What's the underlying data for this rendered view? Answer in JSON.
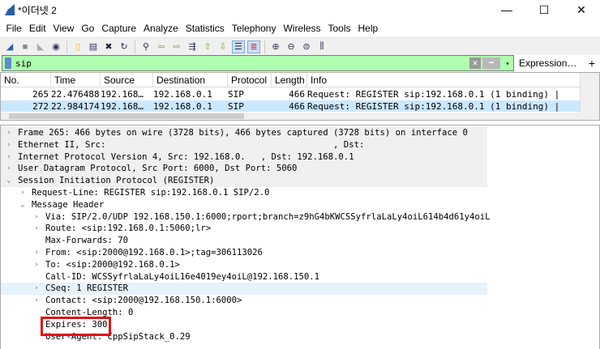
{
  "window": {
    "title": "*이더넷 2",
    "minimize": "—",
    "maximize": "☐",
    "close": "✕"
  },
  "menu": [
    "File",
    "Edit",
    "View",
    "Go",
    "Capture",
    "Analyze",
    "Statistics",
    "Telephony",
    "Wireless",
    "Tools",
    "Help"
  ],
  "toolbar": [
    "start-capture",
    "stop-capture",
    "restart-capture",
    "capture-options",
    "|",
    "open-file",
    "save-file",
    "close-file",
    "reload-file",
    "|",
    "find-packet",
    "go-back",
    "go-forward",
    "go-to-packet",
    "go-first",
    "go-last",
    "autoscroll",
    "colorize",
    "|",
    "zoom-in",
    "zoom-out",
    "normal-size",
    "resize-columns"
  ],
  "filter": {
    "value": "sip",
    "clear": "✕",
    "apply": "➡",
    "dropdown": "▾",
    "expression": "Expression…",
    "add": "+",
    "color": "#afffaf"
  },
  "packet_list": {
    "columns": [
      "No.",
      "Time",
      "Source",
      "Destination",
      "Protocol",
      "Length",
      "Info"
    ],
    "rows": [
      {
        "no": "265",
        "time": "22.476488",
        "source": "192.168…",
        "destination": "192.168.0.1",
        "protocol": "SIP",
        "length": "466",
        "info": "Request: REGISTER sip:192.168.0.1  (1 binding) |",
        "selected": false
      },
      {
        "no": "272",
        "time": "22.984174",
        "source": "192.168…",
        "destination": "192.168.0.1",
        "protocol": "SIP",
        "length": "466",
        "info": "Request: REGISTER sip:192.168.0.1  (1 binding) |",
        "selected": true
      }
    ]
  },
  "details": [
    {
      "indent": 0,
      "arrow": ">",
      "text": "Frame 265: 466 bytes on wire (3728 bits), 466 bytes captured (3728 bits) on interface 0",
      "style": "top"
    },
    {
      "indent": 0,
      "arrow": ">",
      "text": "Ethernet II, Src:                                            , Dst:",
      "style": "top"
    },
    {
      "indent": 0,
      "arrow": ">",
      "text": "Internet Protocol Version 4, Src: 192.168.0.   , Dst: 192.168.0.1",
      "style": "top"
    },
    {
      "indent": 0,
      "arrow": ">",
      "text": "User Datagram Protocol, Src Port: 6000, Dst Port: 5060",
      "style": "top"
    },
    {
      "indent": 0,
      "arrow": "v",
      "text": "Session Initiation Protocol (REGISTER)",
      "style": "top"
    },
    {
      "indent": 1,
      "arrow": ">",
      "text": "Request-Line: REGISTER sip:192.168.0.1 SIP/2.0",
      "style": ""
    },
    {
      "indent": 1,
      "arrow": "v",
      "text": "Message Header",
      "style": ""
    },
    {
      "indent": 2,
      "arrow": ">",
      "text": "Via: SIP/2.0/UDP 192.168.150.1:6000;rport;branch=z9hG4bKWCSSyfrlaLaLy4oiL614b4d61y4oiL",
      "style": ""
    },
    {
      "indent": 2,
      "arrow": ">",
      "text": "Route: <sip:192.168.0.1:5060;lr>",
      "style": ""
    },
    {
      "indent": 2,
      "arrow": "",
      "text": "Max-Forwards: 70",
      "style": ""
    },
    {
      "indent": 2,
      "arrow": ">",
      "text": "From: <sip:2000@192.168.0.1>;tag=306113026",
      "style": ""
    },
    {
      "indent": 2,
      "arrow": ">",
      "text": "To: <sip:2000@192.168.0.1>",
      "style": ""
    },
    {
      "indent": 2,
      "arrow": "",
      "text": "Call-ID: WCSSyfrlaLaLy4oiL16e4019ey4oiL@192.168.150.1",
      "style": ""
    },
    {
      "indent": 2,
      "arrow": ">",
      "text": "CSeq: 1 REGISTER",
      "style": "hl"
    },
    {
      "indent": 2,
      "arrow": ">",
      "text": "Contact: <sip:2000@192.168.150.1:6000>",
      "style": ""
    },
    {
      "indent": 2,
      "arrow": "",
      "text": "Content-Length: 0",
      "style": ""
    },
    {
      "indent": 2,
      "arrow": "",
      "text": "Expires: 300",
      "style": "highlighted-box"
    },
    {
      "indent": 2,
      "arrow": "",
      "text": "User-Agent: CppSipStack_0.29",
      "style": ""
    }
  ],
  "annotation_color": "#e01010"
}
